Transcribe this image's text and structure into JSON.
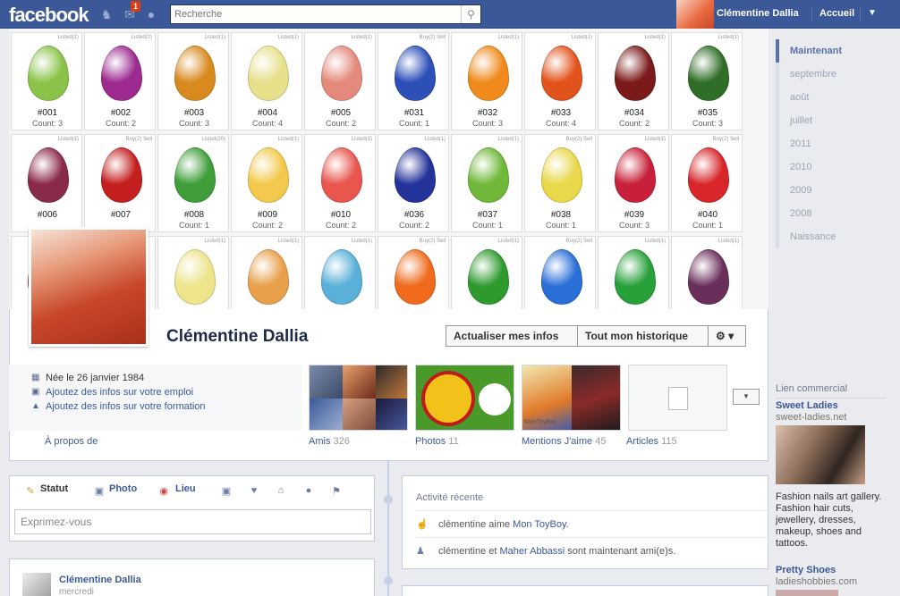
{
  "topbar": {
    "logo": "facebook",
    "notifications_count": "1",
    "search_placeholder": "Recherche",
    "user_name": "Clémentine Dallia",
    "home_label": "Accueil"
  },
  "cover": {
    "eggs": [
      {
        "num": "#001",
        "count": "Count: 3",
        "tag": "Listed(1)",
        "color": "#8bc34a"
      },
      {
        "num": "#002",
        "count": "Count: 2",
        "tag": "Listed(2)",
        "color": "#9c2a8f"
      },
      {
        "num": "#003",
        "count": "Count: 3",
        "tag": "Listed(1)",
        "color": "#d98a1f"
      },
      {
        "num": "#004",
        "count": "Count: 4",
        "tag": "Listed(1)",
        "color": "#e6e08a"
      },
      {
        "num": "#005",
        "count": "Count: 2",
        "tag": "Listed(1)",
        "color": "#e48a7c"
      },
      {
        "num": "#031",
        "count": "Count: 1",
        "tag": "Buy(2) Sell",
        "color": "#2c4fb8"
      },
      {
        "num": "#032",
        "count": "Count: 3",
        "tag": "Listed(1)",
        "color": "#f08a1c"
      },
      {
        "num": "#033",
        "count": "Count: 4",
        "tag": "Listed(1)",
        "color": "#e2531c"
      },
      {
        "num": "#034",
        "count": "Count: 2",
        "tag": "Listed(1)",
        "color": "#7a1a1a"
      },
      {
        "num": "#035",
        "count": "Count: 3",
        "tag": "Listed(1)",
        "color": "#2f6e28"
      },
      {
        "num": "#006",
        "count": "",
        "tag": "Listed(1)",
        "color": "#8a2a4a"
      },
      {
        "num": "#007",
        "count": "",
        "tag": "Buy(2) Sell",
        "color": "#c41f1f"
      },
      {
        "num": "#008",
        "count": "Count: 1",
        "tag": "Listed(20)",
        "color": "#3f9e3a"
      },
      {
        "num": "#009",
        "count": "Count: 2",
        "tag": "Listed(1)",
        "color": "#f2c94c"
      },
      {
        "num": "#010",
        "count": "Count: 2",
        "tag": "Listed(1)",
        "color": "#e8564e"
      },
      {
        "num": "#036",
        "count": "Count: 2",
        "tag": "Listed(1)",
        "color": "#24339a"
      },
      {
        "num": "#037",
        "count": "Count: 1",
        "tag": "Listed(1)",
        "color": "#6fb83a"
      },
      {
        "num": "#038",
        "count": "Count: 1",
        "tag": "Buy(2) Sell",
        "color": "#e8d84a"
      },
      {
        "num": "#039",
        "count": "Count: 3",
        "tag": "Listed(1)",
        "color": "#c8203a"
      },
      {
        "num": "#040",
        "count": "Count: 1",
        "tag": "Buy(2) Sell",
        "color": "#d8262a"
      },
      {
        "num": "",
        "count": "",
        "tag": "",
        "color": "#c2403a"
      },
      {
        "num": "",
        "count": "",
        "tag": "",
        "color": "#e2d27c"
      },
      {
        "num": "",
        "count": "",
        "tag": "Listed(1)",
        "color": "#ede48c"
      },
      {
        "num": "",
        "count": "",
        "tag": "Listed(1)",
        "color": "#e8a04a"
      },
      {
        "num": "",
        "count": "",
        "tag": "Listed(1)",
        "color": "#5ab0d8"
      },
      {
        "num": "",
        "count": "",
        "tag": "Buy(2) Sell",
        "color": "#ef6a1c"
      },
      {
        "num": "",
        "count": "",
        "tag": "Listed(1)",
        "color": "#2e9a2e"
      },
      {
        "num": "",
        "count": "",
        "tag": "Buy(2) Sell",
        "color": "#2a6ed8"
      },
      {
        "num": "",
        "count": "",
        "tag": "Listed(1)",
        "color": "#27a03a"
      },
      {
        "num": "",
        "count": "",
        "tag": "Listed(1)",
        "color": "#6a2e5a"
      }
    ]
  },
  "profile": {
    "name": "Clémentine Dallia",
    "update_info_label": "Actualiser mes infos",
    "history_label": "Tout mon historique",
    "born": "Née le 26 janvier 1984",
    "add_job": "Ajoutez des infos sur votre emploi",
    "add_education": "Ajoutez des infos sur votre formation",
    "about_label": "À propos de",
    "friends_label": "Amis",
    "friends_count": "326",
    "photos_label": "Photos",
    "photos_count": "11",
    "likes_label": "Mentions J'aime",
    "likes_count": "45",
    "articles_label": "Articles",
    "articles_count": "115",
    "likes_thumb_caption": "MonToyBoy"
  },
  "timeline": {
    "items": [
      "Maintenant",
      "septembre",
      "août",
      "juillet",
      "2011",
      "2010",
      "2009",
      "2008",
      "Naissance"
    ]
  },
  "ads": {
    "header": "Lien commercial",
    "ad1_title": "Sweet Ladies",
    "ad1_site": "sweet-ladies.net",
    "ad1_text": "Fashion nails art gallery. Fashion hair cuts, jewellery, dresses, makeup, shoes and tattoos.",
    "ad2_title": "Pretty Shoes",
    "ad2_site": "ladieshobbies.com"
  },
  "composer": {
    "status_label": "Statut",
    "photo_label": "Photo",
    "place_label": "Lieu",
    "placeholder": "Exprimez-vous"
  },
  "activity": {
    "title": "Activité récente",
    "item1_prefix": "clémentine aime ",
    "item1_link": "Mon ToyBoy",
    "item1_suffix": ".",
    "item2_prefix": "clémentine et ",
    "item2_link": "Maher Abbassi",
    "item2_suffix": " sont maintenant ami(e)s."
  },
  "post": {
    "author": "Clémentine Dallia",
    "time": "mercredi"
  },
  "colors": {
    "brand": "#3b5998",
    "link": "#3b5998",
    "badge": "#dd3c10"
  }
}
